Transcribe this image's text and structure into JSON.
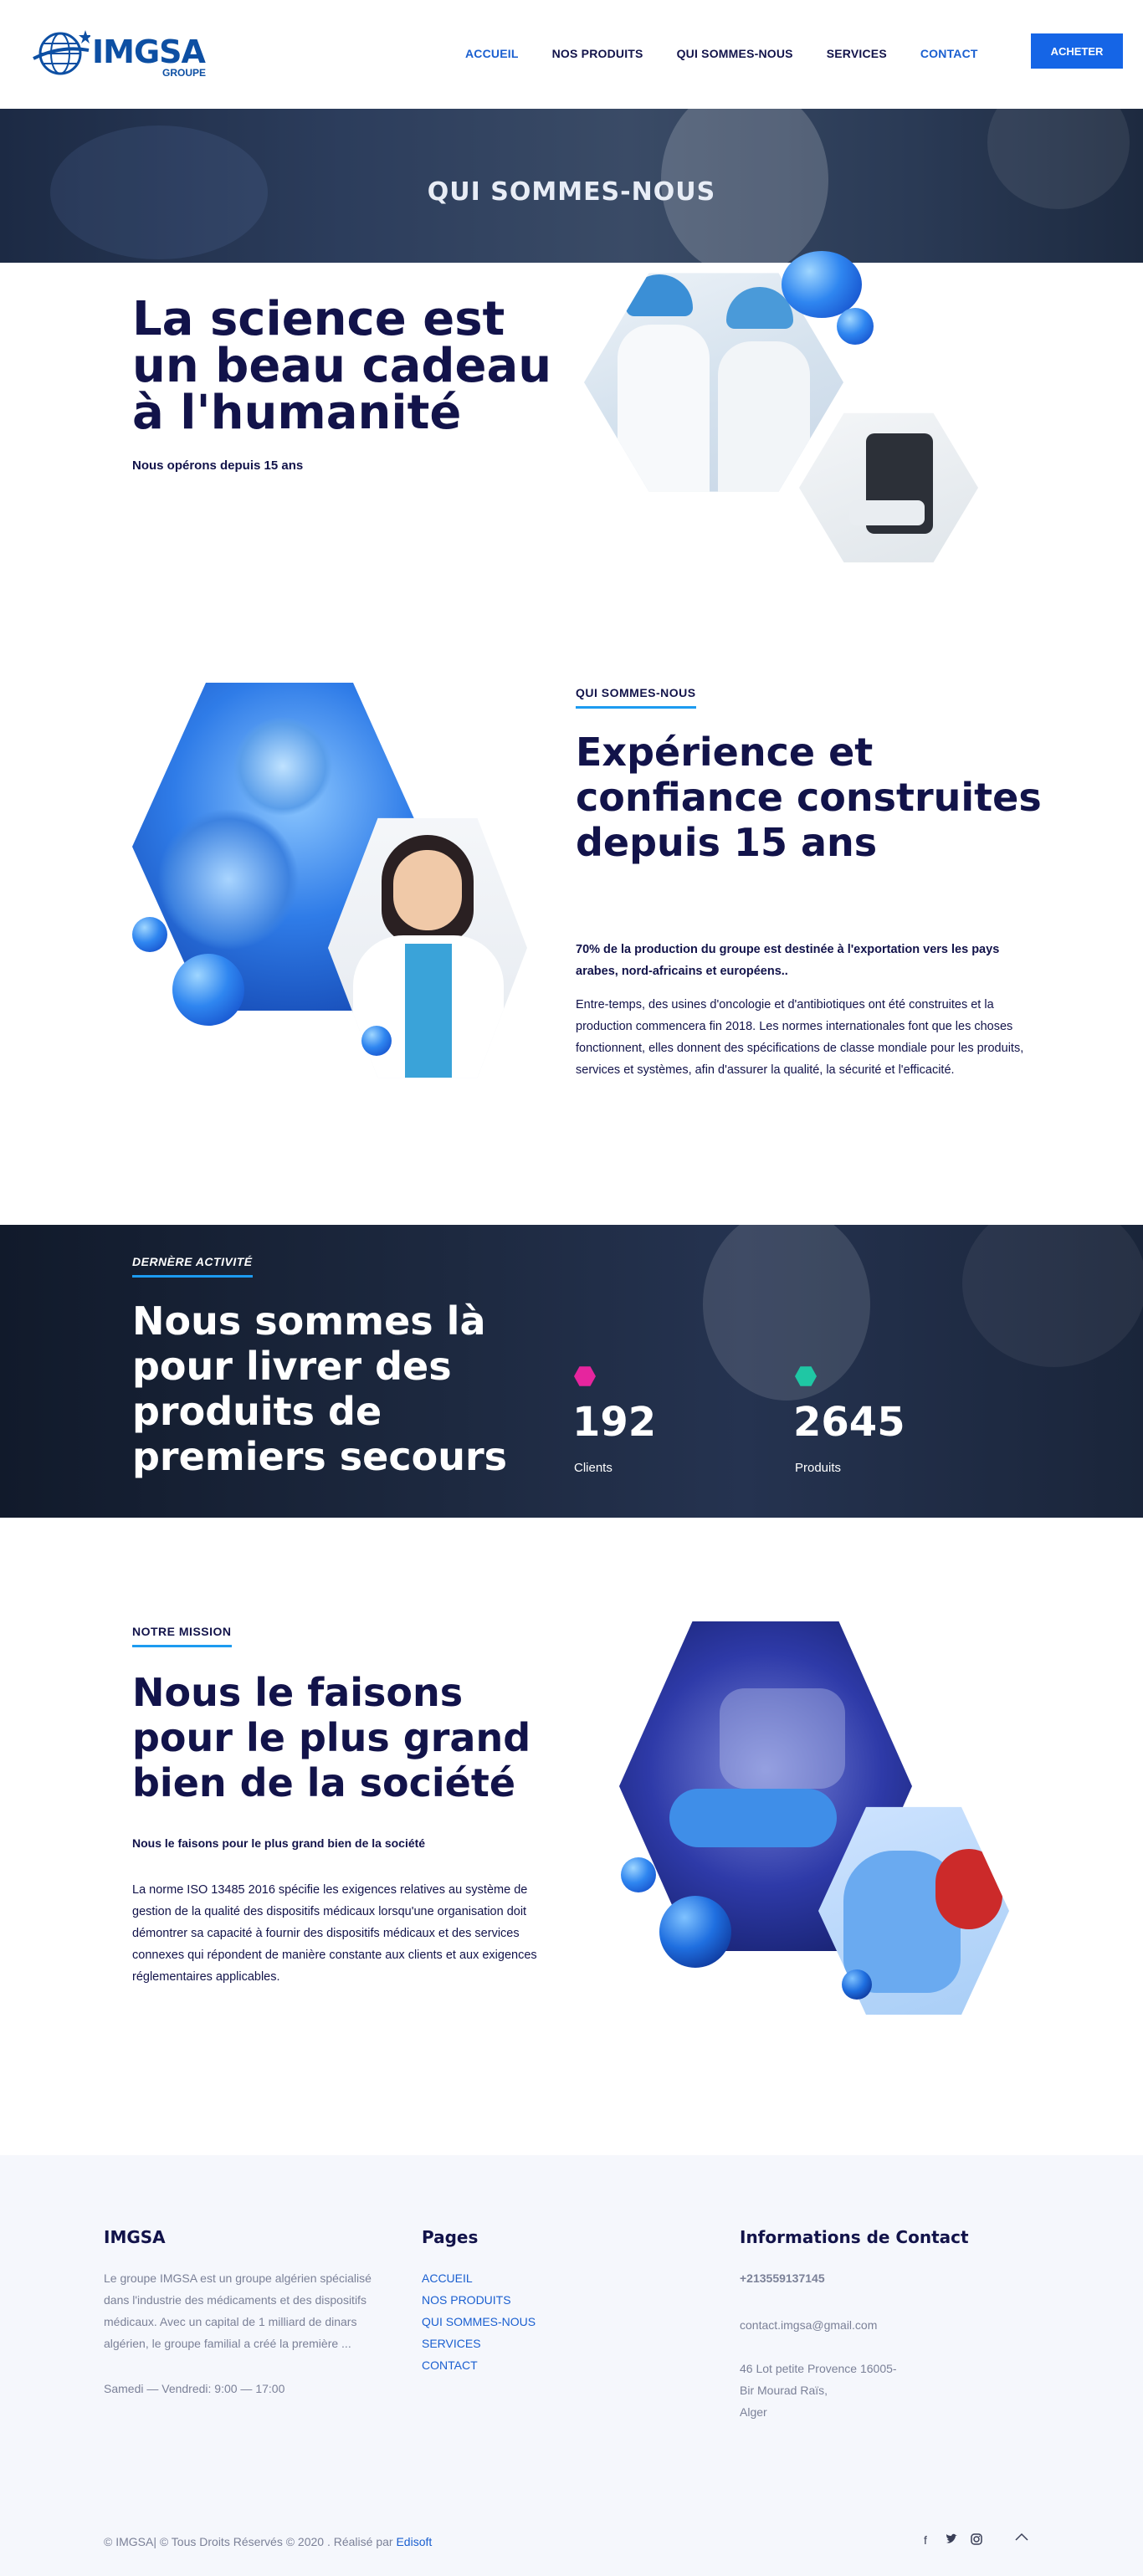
{
  "header": {
    "logo_text": "IMGSA",
    "logo_sub": "GROUPE",
    "nav": [
      {
        "label": "ACCUEIL"
      },
      {
        "label": "NOS PRODUITS"
      },
      {
        "label": "QUI SOMMES-NOUS"
      },
      {
        "label": "SERVICES"
      },
      {
        "label": "CONTACT"
      }
    ],
    "cta_label": "ACHETER"
  },
  "banner": {
    "title": "QUI SOMMES-NOUS"
  },
  "hero": {
    "title": "La science est un beau cadeau à l'humanité",
    "subtitle": "Nous opérons depuis 15 ans"
  },
  "about": {
    "eyebrow": "QUI SOMMES-NOUS",
    "title": "Expérience et confiance construites depuis 15 ans",
    "lead": "70% de la production du groupe est destinée à l'exportation vers les pays arabes, nord-africains et européens..",
    "body": "Entre-temps, des usines d'oncologie et d'antibiotiques ont été construites et la production commencera fin 2018. Les normes internationales font que les choses fonctionnent, elles donnent des spécifications de classe mondiale pour les produits, services et systèmes, afin d'assurer la qualité, la sécurité et l'efficacité."
  },
  "activity": {
    "eyebrow": "DERNÈRE ACTIVITÉ",
    "title": "Nous sommes là pour livrer des produits de premiers secours",
    "stats": [
      {
        "value": "192",
        "label": "Clients",
        "color": "#e6259e"
      },
      {
        "value": "2645",
        "label": "Produits",
        "color": "#1fc7a4"
      }
    ]
  },
  "mission": {
    "eyebrow": "NOTRE MISSION",
    "title": "Nous le faisons pour le plus grand bien de la société",
    "lead": "Nous le faisons pour le plus grand bien de la société",
    "body": "La norme ISO 13485 2016 spécifie les exigences relatives au système de gestion de la qualité des dispositifs médicaux lorsqu'une organisation doit démontrer sa capacité à fournir des dispositifs médicaux et des services connexes qui répondent de manière constante aux clients et aux exigences réglementaires applicables."
  },
  "footer": {
    "col1": {
      "title": "IMGSA",
      "text": "Le groupe IMGSA est un groupe algérien spécialisé dans l'industrie des médicaments et des dispositifs médicaux. Avec un capital de 1 milliard de dinars algérien, le groupe familial a créé la première ...",
      "hours": "Samedi — Vendredi: 9:00 — 17:00"
    },
    "col2": {
      "title": "Pages",
      "links": [
        "ACCUEIL",
        "NOS PRODUITS",
        "QUI SOMMES-NOUS",
        "SERVICES",
        "CONTACT"
      ]
    },
    "col3": {
      "title": "Informations de Contact",
      "phone": "+213559137145",
      "email": "contact.imgsa@gmail.com",
      "address1": "46 Lot petite Provence 16005-",
      "address2": "Bir Mourad Raïs,",
      "address3": "Alger"
    },
    "copyright": "© IMGSA| © Tous Droits Réservés © 2020 . Réalisé par",
    "credit": "Edisoft",
    "social_icons": [
      "facebook-icon",
      "twitter-icon",
      "instagram-icon"
    ],
    "back_to_top": "^"
  },
  "colors": {
    "brand": "#12134a",
    "accent": "#1565e6",
    "underline": "#1d9bf0"
  }
}
